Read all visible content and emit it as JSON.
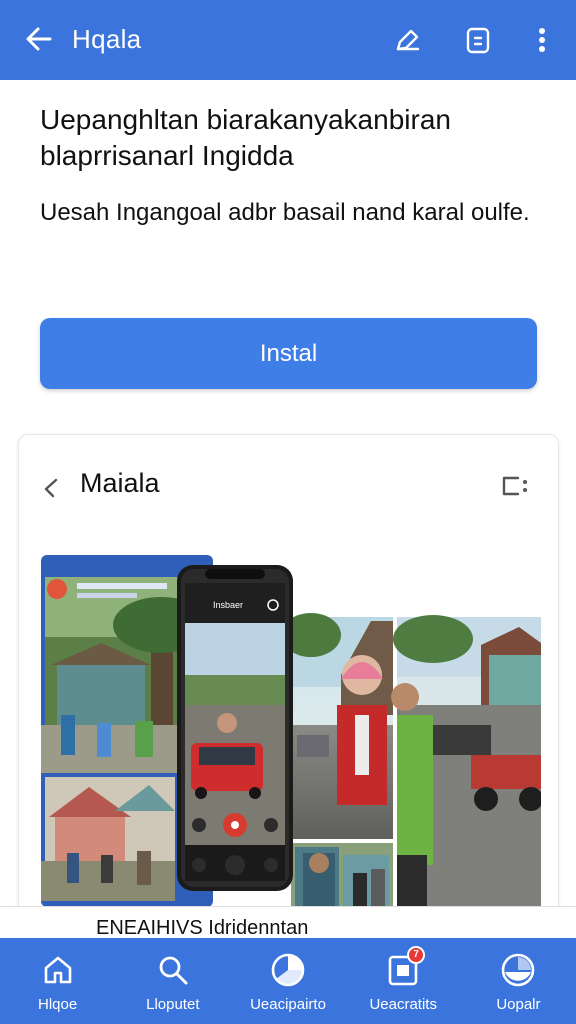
{
  "topbar": {
    "title": "Hqala",
    "back_icon": "arrow-left-icon",
    "actions": [
      "edit-icon",
      "document-icon",
      "more-vertical-icon"
    ],
    "color": "#3b74dc"
  },
  "headline": "Uepanghltan biarakanyakanbiran blaprrisanarl Ingidda",
  "subtitle": "Uesah Ingangoal adbr basail nand karal oulfe.",
  "install_button": {
    "label": "Instal",
    "color": "#3f7ee6"
  },
  "card": {
    "title": "Maiala",
    "back_icon": "chevron-left-icon",
    "menu_icon": "card-menu-icon",
    "phone_header": "Insbaer"
  },
  "bottom_strip": {
    "text": "ENEAIHIVS Idridenntan"
  },
  "bottom_nav": {
    "items": [
      {
        "label": "Hlqoe",
        "icon": "home-icon"
      },
      {
        "label": "Lloputet",
        "icon": "search-icon"
      },
      {
        "label": "Ueacipairto",
        "icon": "pie-icon"
      },
      {
        "label": "Ueacratits",
        "icon": "inbox-icon",
        "badge": "7"
      },
      {
        "label": "Uopalr",
        "icon": "profile-pie-icon"
      }
    ]
  }
}
